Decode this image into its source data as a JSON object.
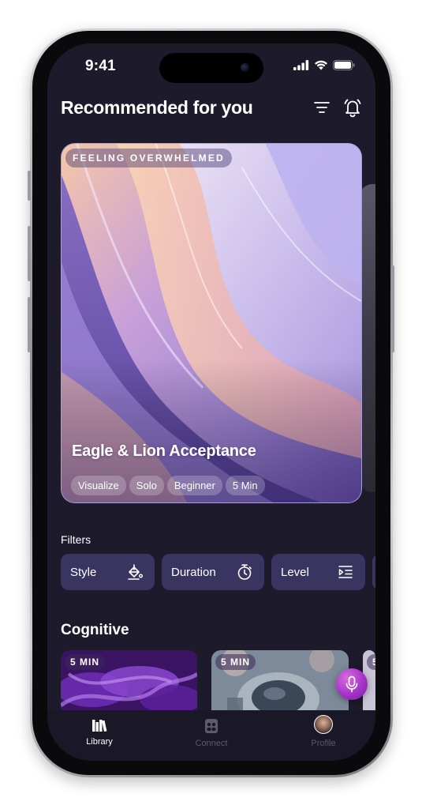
{
  "status_bar": {
    "time": "9:41"
  },
  "header": {
    "title": "Recommended for you"
  },
  "hero": {
    "tag": "FEELING OVERWHELMED",
    "title": "Eagle & Lion Acceptance",
    "chips": [
      "Visualize",
      "Solo",
      "Beginner",
      "5 Min"
    ]
  },
  "filters": {
    "label": "Filters",
    "items": [
      {
        "label": "Style",
        "icon": "paint-bucket-icon"
      },
      {
        "label": "Duration",
        "icon": "stopwatch-icon"
      },
      {
        "label": "Level",
        "icon": "level-list-icon"
      }
    ]
  },
  "cognitive": {
    "title": "Cognitive",
    "cards": [
      {
        "badge": "5 MIN"
      },
      {
        "badge": "5 MIN"
      },
      {
        "badge": "5"
      }
    ]
  },
  "tabbar": {
    "tabs": [
      {
        "label": "Library",
        "icon": "library-icon",
        "active": true
      },
      {
        "label": "Connect",
        "icon": "connect-icon",
        "active": false
      },
      {
        "label": "Profile",
        "icon": "avatar",
        "active": false
      }
    ]
  },
  "colors": {
    "background": "#1d1a2c",
    "filter_button": "#3a3460",
    "accent": "#a533c7",
    "inactive_tab": "#5d5a6e"
  }
}
